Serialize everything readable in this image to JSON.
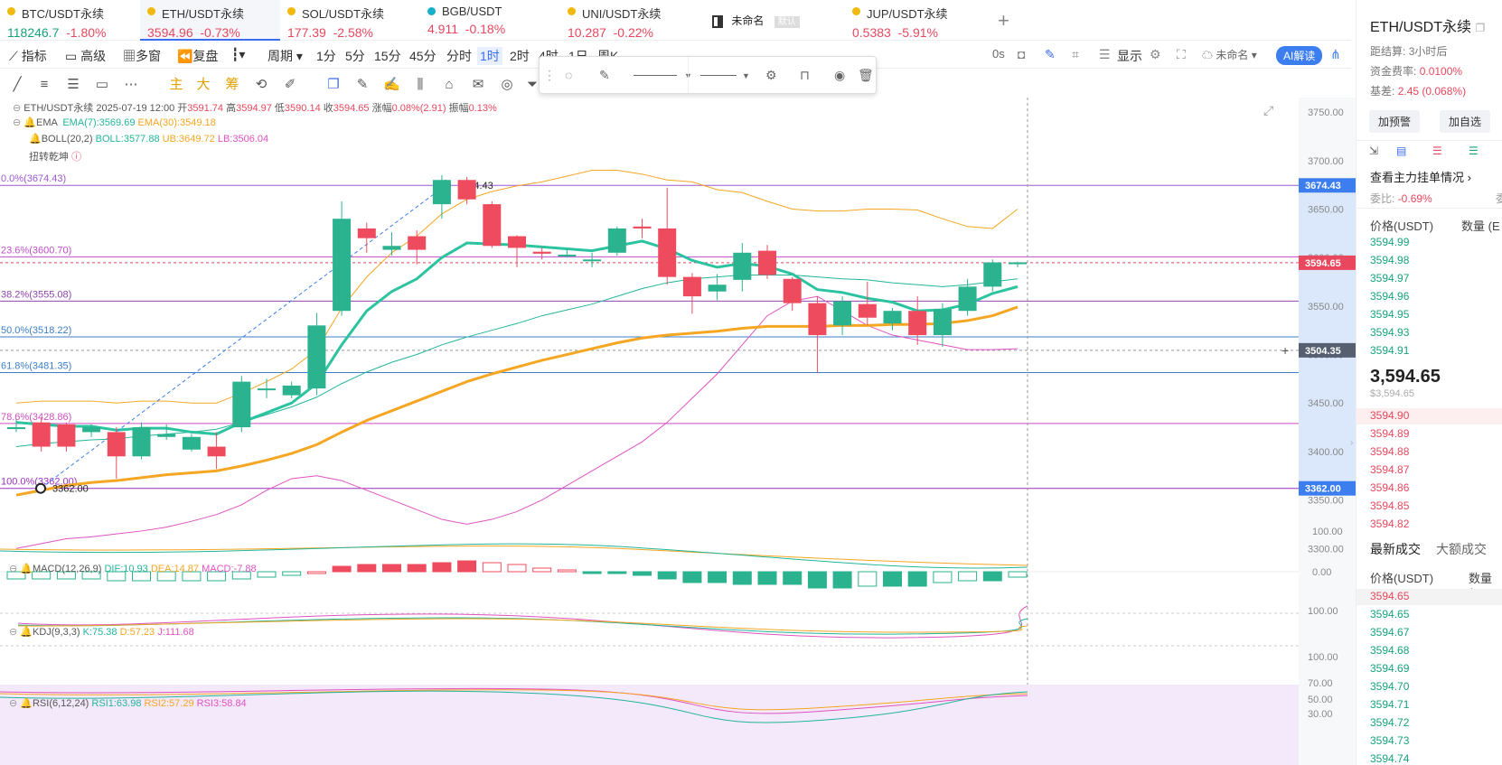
{
  "tabs": [
    {
      "name": "BTC/USDT永续",
      "price": "118246.7",
      "change": "-1.80%",
      "price_dir": "up",
      "change_dir": "dn",
      "icon": "btc-icon"
    },
    {
      "name": "ETH/USDT永续",
      "price": "3594.96",
      "change": "-0.73%",
      "price_dir": "dn",
      "change_dir": "dn",
      "icon": "eth-icon",
      "active": true
    },
    {
      "name": "SOL/USDT永续",
      "price": "177.39",
      "change": "-2.58%",
      "price_dir": "dn",
      "change_dir": "dn",
      "icon": "sol-icon"
    },
    {
      "name": "BGB/USDT",
      "price": "4.911",
      "change": "-0.18%",
      "price_dir": "dn",
      "change_dir": "dn",
      "icon": "bgb-icon"
    },
    {
      "name": "UNI/USDT永续",
      "price": "10.287",
      "change": "-0.22%",
      "price_dir": "dn",
      "change_dir": "dn",
      "icon": "uni-icon"
    },
    {
      "name": "未命名",
      "price": "",
      "change": "",
      "badge": "默认",
      "icon": "layout-icon"
    },
    {
      "name": "JUP/USDT永续",
      "price": "0.5383",
      "change": "-5.91%",
      "price_dir": "dn",
      "change_dir": "dn",
      "icon": "jup-icon"
    }
  ],
  "add_tab_label": "+",
  "toolbar": {
    "indicators": "指标",
    "advanced": "高级",
    "multi_window": "多窗",
    "replay": "复盘",
    "period": "周期",
    "intervals": [
      "1分",
      "5分",
      "15分",
      "45分",
      "分时",
      "1时",
      "2时",
      "4时",
      "1日",
      "周K"
    ],
    "selected_interval": "1时",
    "right_label": "0s",
    "display": "显示",
    "layout_name": "未命名",
    "ai": "AI解读"
  },
  "chart_legend": {
    "symbol": "ETH/USDT永续",
    "date": "2025-07-19 12:00",
    "open_label": "开",
    "open": "3591.74",
    "high_label": "高",
    "high": "3594.97",
    "low_label": "低",
    "low": "3590.14",
    "close_label": "收",
    "close": "3594.65",
    "change_label": "涨幅",
    "change": "0.08%(2.91)",
    "amp_label": "振幅",
    "amp": "0.13%",
    "ema": "EMA",
    "ema7": "EMA(7):3569.69",
    "ema30": "EMA(30):3549.18",
    "boll": "BOLL(20,2)",
    "boll_mid": "BOLL:3577.88",
    "boll_ub": "UB:3649.72",
    "boll_lb": "LB:3506.04",
    "pattern": "扭转乾坤",
    "macd": "MACD(12,26,9)",
    "dif": "DIF:10.93",
    "dea": "DEA:14.87",
    "macd_v": "MACD:-7.88",
    "kdj": "KDJ(9,3,3)",
    "k": "K:75.38",
    "d": "D:57.23",
    "j": "J:111.68",
    "rsi": "RSI(6,12,24)",
    "rsi1": "RSI1:63.98",
    "rsi2": "RSI2:57.29",
    "rsi3": "RSI3:58.84"
  },
  "fib_levels": [
    {
      "label": "0.0%(3674.43)",
      "value": 3674.43,
      "color": "#9b59d0"
    },
    {
      "label": "23.6%(3600.70)",
      "value": 3600.7,
      "color": "#c04ec9"
    },
    {
      "label": "38.2%(3555.08)",
      "value": 3555.08,
      "color": "#8e44ad"
    },
    {
      "label": "50.0%(3518.22)",
      "value": 3518.22,
      "color": "#3c7ec8"
    },
    {
      "label": "61.8%(3481.35)",
      "value": 3481.35,
      "color": "#3c7ec8"
    },
    {
      "label": "78.6%(3428.86)",
      "value": 3428.86,
      "color": "#d04ec0"
    },
    {
      "label": "100.0%(3362.00)",
      "value": 3362.0,
      "color": "#9b30c0"
    }
  ],
  "point_labels": {
    "high": "3674.43",
    "low": "3362.00"
  },
  "chart_data": {
    "type": "candlestick",
    "price_axis_ticks": [
      "3750.00",
      "3700.00",
      "3650.00",
      "3600.00",
      "3550.00",
      "3500.00",
      "3450.00",
      "3400.00",
      "3350.00",
      "3300.00"
    ],
    "price_range": [
      3290,
      3765
    ],
    "price_badges": [
      {
        "label": "3674.43",
        "value": 3674.43,
        "color": "#3c7ef0"
      },
      {
        "label": "3594.65",
        "value": 3594.65,
        "color": "#e8475d"
      },
      {
        "label": "3504.35",
        "value": 3504.35,
        "color": "#555f70"
      },
      {
        "label": "3362.00",
        "value": 3362.0,
        "color": "#3c7ef0"
      }
    ],
    "candles": [
      [
        3425,
        3425,
        3433,
        3420
      ],
      [
        3430,
        3405,
        3435,
        3400
      ],
      [
        3428,
        3405,
        3430,
        3400
      ],
      [
        3420,
        3425,
        3428,
        3415
      ],
      [
        3420,
        3395,
        3425,
        3372
      ],
      [
        3395,
        3425,
        3430,
        3392
      ],
      [
        3415,
        3418,
        3428,
        3412
      ],
      [
        3402,
        3415,
        3418,
        3400
      ],
      [
        3405,
        3395,
        3420,
        3382
      ],
      [
        3425,
        3472,
        3478,
        3420
      ],
      [
        3465,
        3465,
        3475,
        3455
      ],
      [
        3458,
        3468,
        3472,
        3455
      ],
      [
        3465,
        3530,
        3543,
        3458
      ],
      [
        3545,
        3640,
        3658,
        3540
      ],
      [
        3630,
        3620,
        3636,
        3605
      ],
      [
        3608,
        3612,
        3626,
        3602
      ],
      [
        3622,
        3608,
        3628,
        3593
      ],
      [
        3655,
        3680,
        3685,
        3640
      ],
      [
        3680,
        3660,
        3683,
        3655
      ],
      [
        3655,
        3612,
        3658,
        3610
      ],
      [
        3622,
        3610,
        3623,
        3590
      ],
      [
        3606,
        3604,
        3610,
        3598
      ],
      [
        3603,
        3603,
        3609,
        3600
      ],
      [
        3598,
        3598,
        3605,
        3590
      ],
      [
        3605,
        3630,
        3632,
        3602
      ],
      [
        3632,
        3630,
        3640,
        3620
      ],
      [
        3630,
        3580,
        3672,
        3572
      ],
      [
        3580,
        3560,
        3584,
        3542
      ],
      [
        3565,
        3572,
        3583,
        3556
      ],
      [
        3577,
        3605,
        3615,
        3565
      ],
      [
        3607,
        3582,
        3613,
        3578
      ],
      [
        3578,
        3553,
        3580,
        3545
      ],
      [
        3553,
        3520,
        3560,
        3481
      ],
      [
        3530,
        3555,
        3560,
        3520
      ],
      [
        3552,
        3538,
        3575,
        3530
      ],
      [
        3532,
        3545,
        3548,
        3525
      ],
      [
        3545,
        3520,
        3560,
        3510
      ],
      [
        3520,
        3547,
        3553,
        3508
      ],
      [
        3545,
        3570,
        3578,
        3540
      ],
      [
        3570,
        3595,
        3598,
        3565
      ],
      [
        3594,
        3595,
        3596,
        3590
      ]
    ],
    "ema7": [
      3430,
      3428,
      3426,
      3426,
      3422,
      3424,
      3424,
      3420,
      3418,
      3430,
      3440,
      3450,
      3470,
      3510,
      3545,
      3565,
      3578,
      3600,
      3615,
      3614,
      3613,
      3611,
      3609,
      3607,
      3612,
      3617,
      3609,
      3597,
      3590,
      3594,
      3591,
      3583,
      3567,
      3564,
      3558,
      3554,
      3545,
      3546,
      3552,
      3563,
      3570
    ],
    "ema30": [
      3355,
      3360,
      3365,
      3368,
      3370,
      3373,
      3376,
      3378,
      3380,
      3385,
      3391,
      3398,
      3407,
      3420,
      3432,
      3442,
      3452,
      3462,
      3472,
      3480,
      3487,
      3494,
      3500,
      3506,
      3512,
      3517,
      3520,
      3522,
      3524,
      3527,
      3529,
      3529,
      3529,
      3530,
      3530,
      3531,
      3531,
      3532,
      3535,
      3540,
      3549
    ],
    "boll_mid": [
      3405,
      3408,
      3410,
      3412,
      3413,
      3416,
      3418,
      3420,
      3423,
      3430,
      3438,
      3446,
      3456,
      3470,
      3482,
      3492,
      3500,
      3510,
      3518,
      3525,
      3532,
      3540,
      3546,
      3552,
      3560,
      3568,
      3574,
      3578,
      3580,
      3582,
      3582,
      3582,
      3580,
      3578,
      3577,
      3574,
      3572,
      3570,
      3572,
      3575,
      3578
    ],
    "boll_ub": [
      3450,
      3452,
      3452,
      3452,
      3450,
      3452,
      3452,
      3450,
      3450,
      3460,
      3472,
      3485,
      3505,
      3548,
      3580,
      3605,
      3622,
      3645,
      3660,
      3668,
      3674,
      3678,
      3684,
      3690,
      3690,
      3686,
      3680,
      3678,
      3670,
      3667,
      3658,
      3650,
      3648,
      3648,
      3650,
      3650,
      3649,
      3640,
      3632,
      3630,
      3650
    ],
    "boll_lb": [
      3300,
      3305,
      3310,
      3312,
      3315,
      3318,
      3322,
      3328,
      3335,
      3345,
      3360,
      3372,
      3375,
      3370,
      3360,
      3350,
      3340,
      3330,
      3325,
      3330,
      3338,
      3350,
      3365,
      3380,
      3395,
      3410,
      3430,
      3455,
      3480,
      3510,
      3540,
      3555,
      3560,
      3545,
      3530,
      3520,
      3515,
      3510,
      3505,
      3505,
      3506
    ],
    "macd_hist": [
      -4,
      -4,
      -4,
      -4,
      -5,
      -5,
      -5,
      -5,
      -5,
      -4,
      -3,
      -2,
      0,
      3,
      4,
      4,
      4,
      5,
      6,
      5,
      4,
      2,
      1,
      -1,
      -1,
      -2,
      -4,
      -6,
      -6,
      -7,
      -7,
      -7,
      -9,
      -9,
      -8,
      -8,
      -8,
      -6,
      -5,
      -5,
      -3
    ],
    "macd_range": [
      -12,
      10
    ],
    "macd_ticks": [
      "100.00",
      "0.00"
    ],
    "kdj_ticks": [
      "100.00"
    ],
    "rsi_ticks": [
      "100.00",
      "70.00",
      "50.00",
      "30.00"
    ]
  },
  "right_panel": {
    "title": "ETH/USDT永续",
    "settle_label": "距结算:",
    "settle": "3小时后",
    "funding_label": "资金费率:",
    "funding": "0.0100%",
    "basis_label": "基差:",
    "basis": "2.45 (0.068%)",
    "alert_btn": "加预警",
    "fav_btn": "加自选",
    "orderbook_link": "查看主力挂单情况",
    "ratio_label": "委比:",
    "ratio": "-0.69%",
    "ratio_tail": "委",
    "price_header": "价格(USDT)",
    "qty_header": "数量 (E",
    "asks": [
      "3594.99",
      "3594.98",
      "3594.97",
      "3594.96",
      "3594.95",
      "3594.93",
      "3594.91"
    ],
    "last_price": "3,594.65",
    "last_sub": "$3,594.65",
    "bids": [
      "3594.90",
      "3594.89",
      "3594.88",
      "3594.87",
      "3594.86",
      "3594.85",
      "3594.82"
    ],
    "trades_tab": "最新成交",
    "big_trades_tab": "大额成交",
    "trade_price_header": "价格(USDT)",
    "trade_qty_header": "数量(E",
    "trades": [
      "3594.65",
      "3594.65",
      "3594.67",
      "3594.68",
      "3594.69",
      "3594.70",
      "3594.71",
      "3594.72",
      "3594.73",
      "3594.74"
    ]
  }
}
